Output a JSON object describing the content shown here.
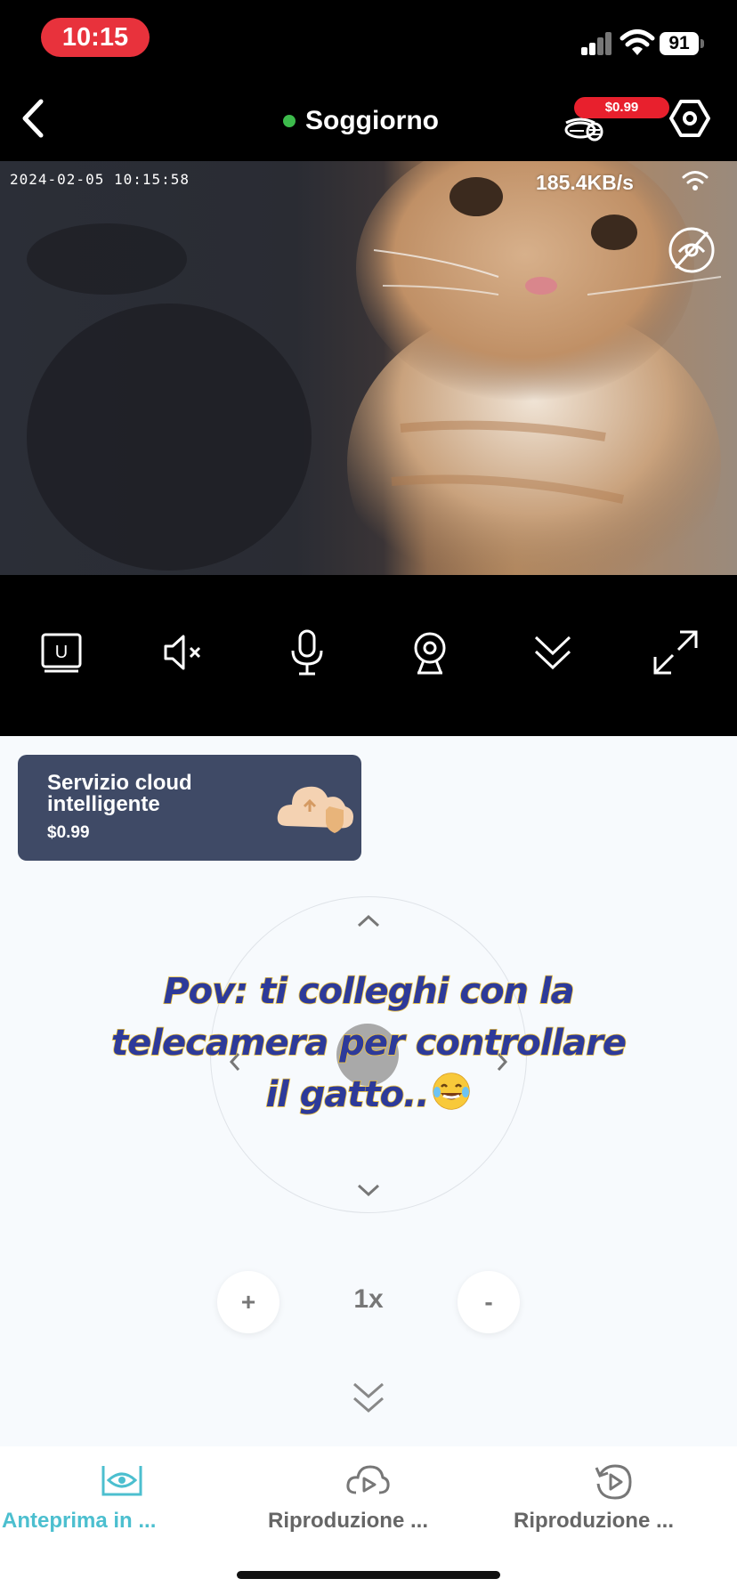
{
  "status_bar": {
    "time": "10:15",
    "battery": "91"
  },
  "header": {
    "title": "Soggiorno",
    "online_color": "#3dbb4c",
    "price_badge": "$0.99"
  },
  "video": {
    "timestamp": "2024-02-05  10:15:58",
    "bitrate": "185.4KB/s"
  },
  "controls": [
    "u-stream-icon",
    "mute-icon",
    "microphone-icon",
    "camera-icon",
    "collapse-icon",
    "fullscreen-icon"
  ],
  "cloud_banner": {
    "title": "Servizio cloud intelligente",
    "price": "$0.99",
    "background": "#3f4a66"
  },
  "overlay_caption": {
    "line1": "Pov: ti colleghi con la",
    "line2": "telecamera per controllare",
    "line3": "il gatto.."
  },
  "zoom": {
    "plus": "+",
    "level": "1x",
    "minus": "-"
  },
  "tabs": [
    {
      "label": "Anteprima in ...",
      "active": true,
      "color": "#4cbfcf"
    },
    {
      "label": "Riproduzione ...",
      "active": false,
      "color": "#666666"
    },
    {
      "label": "Riproduzione ...",
      "active": false,
      "color": "#666666"
    }
  ]
}
